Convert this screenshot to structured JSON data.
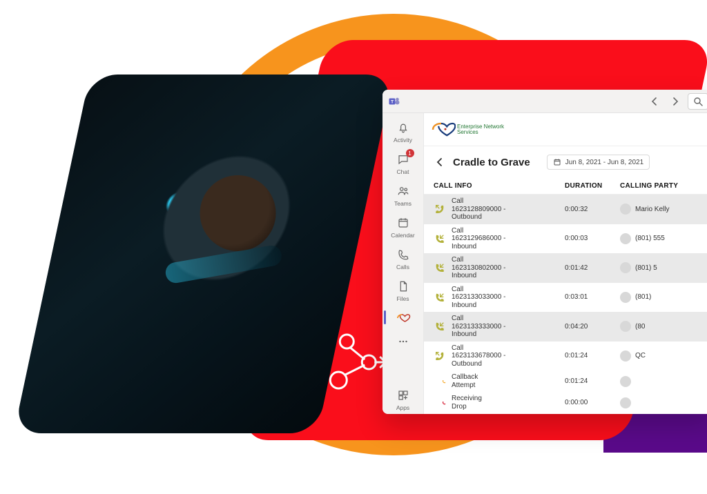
{
  "rail": {
    "activity": "Activity",
    "chat": "Chat",
    "chat_badge": "1",
    "teams": "Teams",
    "calendar": "Calendar",
    "calls": "Calls",
    "files": "Files",
    "apps": "Apps"
  },
  "brand": {
    "name_line1": "Enterprise Network",
    "name_line2": "Services"
  },
  "page": {
    "title": "Cradle to Grave",
    "date_range": "Jun 8, 2021 - Jun 8, 2021"
  },
  "columns": {
    "info": "CALL INFO",
    "duration": "DURATION",
    "party": "CALLING PARTY"
  },
  "rows": [
    {
      "label": "Call",
      "id": "1623128809000 -",
      "dir": "Outbound",
      "dur": "0:00:32",
      "party": "Mario Kelly",
      "icon": "outbound",
      "alt": true
    },
    {
      "label": "Call",
      "id": "1623129686000 -",
      "dir": "Inbound",
      "dur": "0:00:03",
      "party": "(801) 555",
      "icon": "inbound",
      "alt": false
    },
    {
      "label": "Call",
      "id": "1623130802000 -",
      "dir": "Inbound",
      "dur": "0:01:42",
      "party": "(801) 5",
      "icon": "inbound",
      "alt": true
    },
    {
      "label": "Call",
      "id": "1623133033000 -",
      "dir": "Inbound",
      "dur": "0:03:01",
      "party": "(801)",
      "icon": "inbound",
      "alt": false
    },
    {
      "label": "Call",
      "id": "1623133333000 -",
      "dir": "Inbound",
      "dur": "0:04:20",
      "party": "(80",
      "icon": "inbound",
      "alt": true
    },
    {
      "label": "Call",
      "id": "1623133678000 -",
      "dir": "Outbound",
      "dur": "0:01:24",
      "party": "QC",
      "icon": "outbound",
      "alt": false
    },
    {
      "label": "Callback",
      "id": "Attempt",
      "dir": "",
      "dur": "0:01:24",
      "party": "",
      "icon": "callback",
      "alt": false,
      "indent": true
    },
    {
      "label": "Receiving",
      "id": "Drop",
      "dir": "",
      "dur": "0:00:00",
      "party": "",
      "icon": "drop",
      "alt": false,
      "indent": true
    }
  ]
}
